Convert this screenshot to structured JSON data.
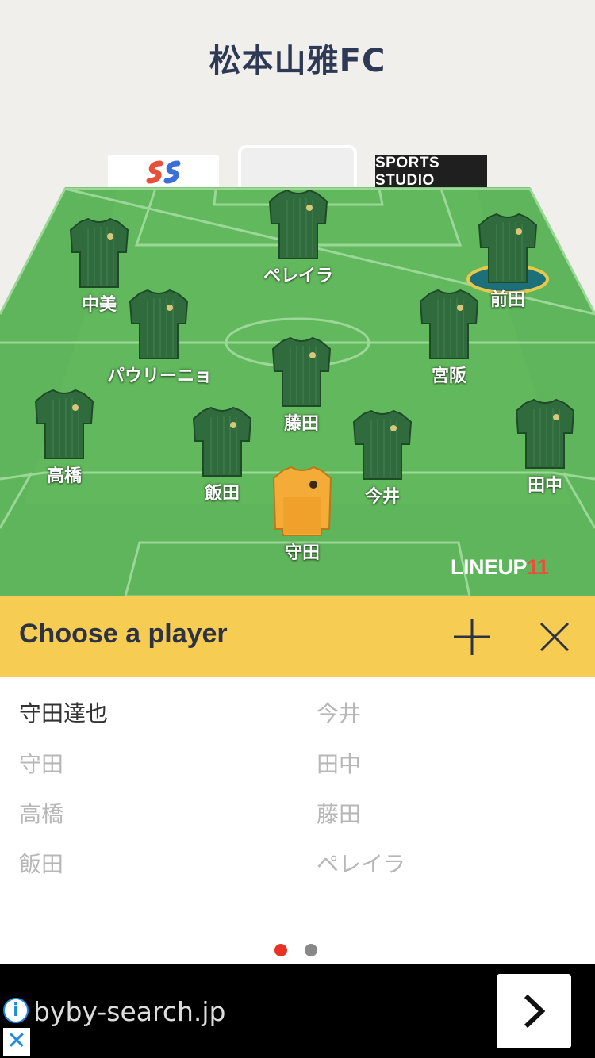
{
  "team": {
    "name": "松本山雅FC"
  },
  "sponsors": {
    "right": "SPORTS STUDIO"
  },
  "players_on_pitch": [
    {
      "name": "ペレイラ",
      "kit": "field"
    },
    {
      "name": "中美",
      "kit": "field"
    },
    {
      "name": "前田",
      "kit": "field",
      "selected": true
    },
    {
      "name": "パウリーニョ",
      "kit": "field"
    },
    {
      "name": "宮阪",
      "kit": "field"
    },
    {
      "name": "藤田",
      "kit": "field"
    },
    {
      "name": "高橋",
      "kit": "field"
    },
    {
      "name": "飯田",
      "kit": "field"
    },
    {
      "name": "今井",
      "kit": "field"
    },
    {
      "name": "田中",
      "kit": "field"
    },
    {
      "name": "守田",
      "kit": "keeper"
    }
  ],
  "brand": {
    "main": "LINEUP",
    "num": "11"
  },
  "chooser": {
    "title": "Choose a player",
    "add_icon": "plus-icon",
    "close_icon": "close-icon",
    "left_column": [
      "守田達也",
      "守田",
      "高橋",
      "飯田"
    ],
    "right_column": [
      "今井",
      "田中",
      "藤田",
      "ペレイラ"
    ],
    "active_item": "守田達也"
  },
  "pagination": {
    "pages": 2,
    "current": 1,
    "active_color": "#e63325",
    "inactive_color": "#888888"
  },
  "ad": {
    "text": "byby-search.jp",
    "info_icon": "info-icon",
    "close_icon": "close-icon",
    "next_icon": "chevron-right-icon"
  },
  "colors": {
    "pitch": "#5fb55b",
    "kit_field": "#2f6b3c",
    "kit_keeper": "#f4ab37",
    "bar": "#f6cd52",
    "title": "#2e3a55"
  }
}
